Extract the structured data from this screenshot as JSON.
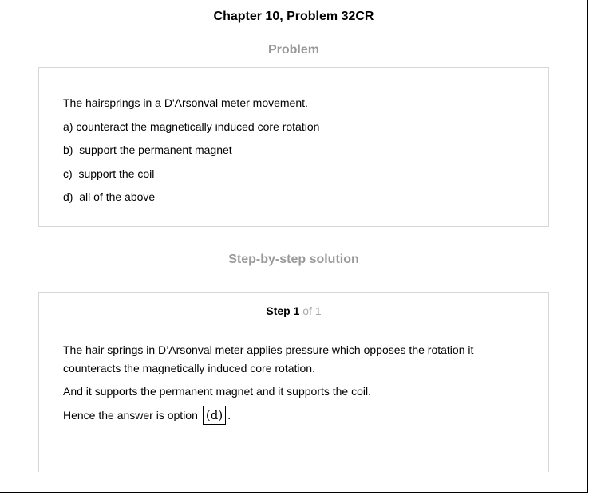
{
  "chapter_title": "Chapter 10, Problem 32CR",
  "problem": {
    "heading": "Problem",
    "question": "The hairsprings in a D'Arsonval meter movement.",
    "options": [
      "a) counteract the magnetically induced core rotation",
      "b)  support the permanent magnet",
      "c)  support the coil",
      "d)  all of the above"
    ]
  },
  "solution": {
    "heading": "Step-by-step solution",
    "step_label": "Step 1",
    "step_of": "of 1",
    "paragraph_1": "The hair springs in D’Arsonval meter applies pressure which opposes the rotation it counteracts the magnetically induced core rotation.",
    "paragraph_2": "And it supports the permanent magnet and it supports the coil.",
    "answer_prefix": "Hence the answer is option",
    "answer_value": "(d)",
    "answer_suffix": "."
  }
}
